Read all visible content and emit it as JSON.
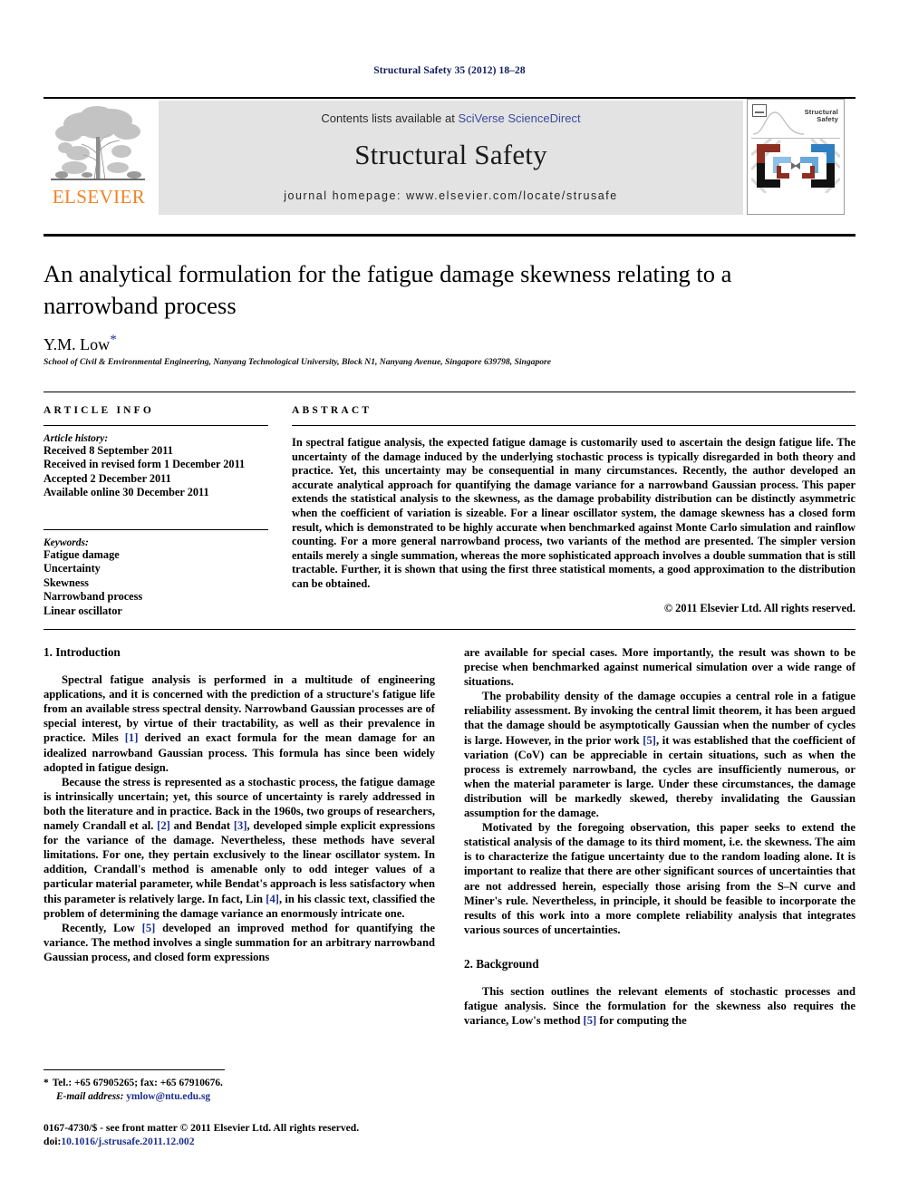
{
  "running_head": "Structural Safety 35 (2012) 18–28",
  "masthead": {
    "elsevier_wordmark": "ELSEVIER",
    "contents_prefix": "Contents lists available at ",
    "contents_link": "SciVerse ScienceDirect",
    "journal_title": "Structural Safety",
    "homepage": "journal homepage: www.elsevier.com/locate/strusafe",
    "cover": {
      "line1": "Structural",
      "line2": "Safety"
    },
    "colors": {
      "banner_bg": "#e3e3e3",
      "elsevier_orange": "#f08324",
      "link_blue": "#3b4ba0"
    }
  },
  "article": {
    "title": "An analytical formulation for the fatigue damage skewness relating to a narrowband process",
    "author": "Y.M. Low",
    "author_marker": "*",
    "affiliation": "School of Civil & Environmental Engineering, Nanyang Technological University, Block N1, Nanyang Avenue, Singapore 639798, Singapore"
  },
  "article_info": {
    "heading": "ARTICLE INFO",
    "history_label": "Article history:",
    "history": [
      "Received 8 September 2011",
      "Received in revised form 1 December 2011",
      "Accepted 2 December 2011",
      "Available online 30 December 2011"
    ],
    "keywords_label": "Keywords:",
    "keywords": [
      "Fatigue damage",
      "Uncertainty",
      "Skewness",
      "Narrowband process",
      "Linear oscillator"
    ]
  },
  "abstract": {
    "heading": "ABSTRACT",
    "text": "In spectral fatigue analysis, the expected fatigue damage is customarily used to ascertain the design fatigue life. The uncertainty of the damage induced by the underlying stochastic process is typically disregarded in both theory and practice. Yet, this uncertainty may be consequential in many circumstances. Recently, the author developed an accurate analytical approach for quantifying the damage variance for a narrowband Gaussian process. This paper extends the statistical analysis to the skewness, as the damage probability distribution can be distinctly asymmetric when the coefficient of variation is sizeable. For a linear oscillator system, the damage skewness has a closed form result, which is demonstrated to be highly accurate when benchmarked against Monte Carlo simulation and rainflow counting. For a more general narrowband process, two variants of the method are presented. The simpler version entails merely a single summation, whereas the more sophisticated approach involves a double summation that is still tractable. Further, it is shown that using the first three statistical moments, a good approximation to the distribution can be obtained.",
    "copyright": "© 2011 Elsevier Ltd. All rights reserved."
  },
  "body": {
    "section1_heading": "1. Introduction",
    "section2_heading": "2. Background",
    "left": {
      "p1_a": "Spectral fatigue analysis is performed in a multitude of engineering applications, and it is concerned with the prediction of a structure's fatigue life from an available stress spectral density. Narrowband Gaussian processes are of special interest, by virtue of their tractability, as well as their prevalence in practice. Miles ",
      "p1_cite": "[1]",
      "p1_b": " derived an exact formula for the mean damage for an idealized narrowband Gaussian process. This formula has since been widely adopted in fatigue design.",
      "p2_a": "Because the stress is represented as a stochastic process, the fatigue damage is intrinsically uncertain; yet, this source of uncertainty is rarely addressed in both the literature and in practice. Back in the 1960s, two groups of researchers, namely Crandall et al. ",
      "p2_cite1": "[2]",
      "p2_b": " and Bendat ",
      "p2_cite2": "[3]",
      "p2_c": ", developed simple explicit expressions for the variance of the damage. Nevertheless, these methods have several limitations. For one, they pertain exclusively to the linear oscillator system. In addition, Crandall's method is amenable only to odd integer values of a particular material parameter, while Bendat's approach is less satisfactory when this parameter is relatively large. In fact, Lin ",
      "p2_cite3": "[4]",
      "p2_d": ", in his classic text, classified the problem of determining the damage variance an enormously intricate one.",
      "p3_a": "Recently, Low ",
      "p3_cite": "[5]",
      "p3_b": " developed an improved method for quantifying the variance. The method involves a single summation for an arbitrary narrowband Gaussian process, and closed form expressions"
    },
    "right": {
      "p3_cont": "are available for special cases. More importantly, the result was shown to be precise when benchmarked against numerical simulation over a wide range of situations.",
      "p4_a": "The probability density of the damage occupies a central role in a fatigue reliability assessment. By invoking the central limit theorem, it has been argued that the damage should be asymptotically Gaussian when the number of cycles is large. However, in the prior work ",
      "p4_cite": "[5]",
      "p4_b": ", it was established that the coefficient of variation (CoV) can be appreciable in certain situations, such as when the process is extremely narrowband, the cycles are insufficiently numerous, or when the material parameter is large. Under these circumstances, the damage distribution will be markedly skewed, thereby invalidating the Gaussian assumption for the damage.",
      "p5": "Motivated by the foregoing observation, this paper seeks to extend the statistical analysis of the damage to its third moment, i.e. the skewness. The aim is to characterize the fatigue uncertainty due to the random loading alone. It is important to realize that there are other significant sources of uncertainties that are not addressed herein, especially those arising from the S–N curve and Miner's rule. Nevertheless, in principle, it should be feasible to incorporate the results of this work into a more complete reliability analysis that integrates various sources of uncertainties.",
      "p6_a": "This section outlines the relevant elements of stochastic processes and fatigue analysis. Since the formulation for the skewness also requires the variance, Low's method ",
      "p6_cite": "[5]",
      "p6_b": " for computing the"
    }
  },
  "footnote": {
    "marker": "*",
    "contact": "Tel.: +65 67905265; fax: +65 67910676.",
    "email_label": "E-mail address:",
    "email": "ymlow@ntu.edu.sg"
  },
  "footer": {
    "front_matter": "0167-4730/$ - see front matter © 2011 Elsevier Ltd. All rights reserved.",
    "doi_label": "doi:",
    "doi": "10.1016/j.strusafe.2011.12.002"
  }
}
